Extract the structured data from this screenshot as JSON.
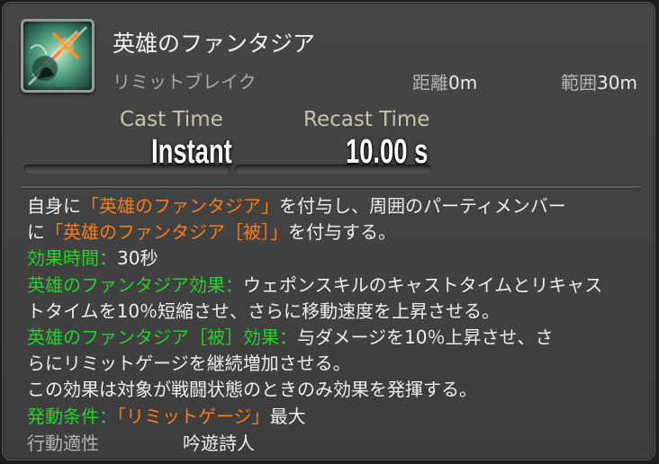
{
  "skill": {
    "icon": "fantasia-limit-break-icon",
    "name": "英雄のファンタジア",
    "category": "リミットブレイク",
    "range_label": "距離",
    "range_value": "0m",
    "radius_label": "範囲",
    "radius_value": "30m"
  },
  "timing": {
    "cast_label": "Cast Time",
    "cast_value": "Instant",
    "recast_label": "Recast Time",
    "recast_value": "10.00 s"
  },
  "description": {
    "l1_a": "自身に",
    "l1_b": "「英雄のファンタジア」",
    "l1_c": "を付与し、周囲のパーティメンバー",
    "l2_a": "に",
    "l2_b": "「英雄のファンタジア［被］」",
    "l2_c": "を付与する。",
    "l3_a": "効果時間：",
    "l3_b": "30秒",
    "l4_a": "英雄のファンタジア効果：",
    "l4_b": "ウェポンスキルのキャストタイムとリキャス",
    "l5": "トタイムを10％短縮させ、さらに移動速度を上昇させる。",
    "l6_a": "英雄のファンタジア［被］効果：",
    "l6_b": "与ダメージを10％上昇させ、さ",
    "l7": "らにリミットゲージを継続増加させる。",
    "l8": "この効果は対象が戦闘状態のときのみ効果を発揮する。",
    "l9_a": "発動条件：",
    "l9_b": "「リミットゲージ」",
    "l9_c": "最大"
  },
  "trait": {
    "label": "行動適性",
    "value": "吟遊詩人"
  },
  "colors": {
    "highlight_orange": "#ff7b1a",
    "highlight_green": "#22d42a"
  }
}
